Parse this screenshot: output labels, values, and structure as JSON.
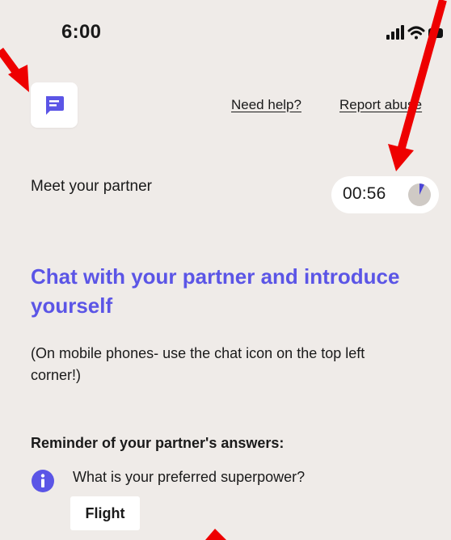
{
  "status_bar": {
    "time": "6:00"
  },
  "header": {
    "help_link": "Need help?",
    "report_link": "Report abuse"
  },
  "partner_row": {
    "title": "Meet your partner",
    "timer": "00:56",
    "timer_progress": 0.07
  },
  "main": {
    "heading": "Chat with your partner and introduce yourself",
    "note": "(On mobile phones- use the chat icon on the top left corner!)",
    "reminder_title": "Reminder of your partner's answers:",
    "question": "What is your preferred superpower?",
    "answer": "Flight"
  },
  "colors": {
    "background": "#efebe8",
    "accent": "#5b55e6",
    "annotation_arrow": "#ee0000"
  },
  "icons": {
    "chat": "chat-bubble-icon",
    "info": "info-icon",
    "signal": "cellular-signal-icon",
    "wifi": "wifi-icon",
    "battery": "battery-icon",
    "timer": "timer-pie-icon"
  }
}
